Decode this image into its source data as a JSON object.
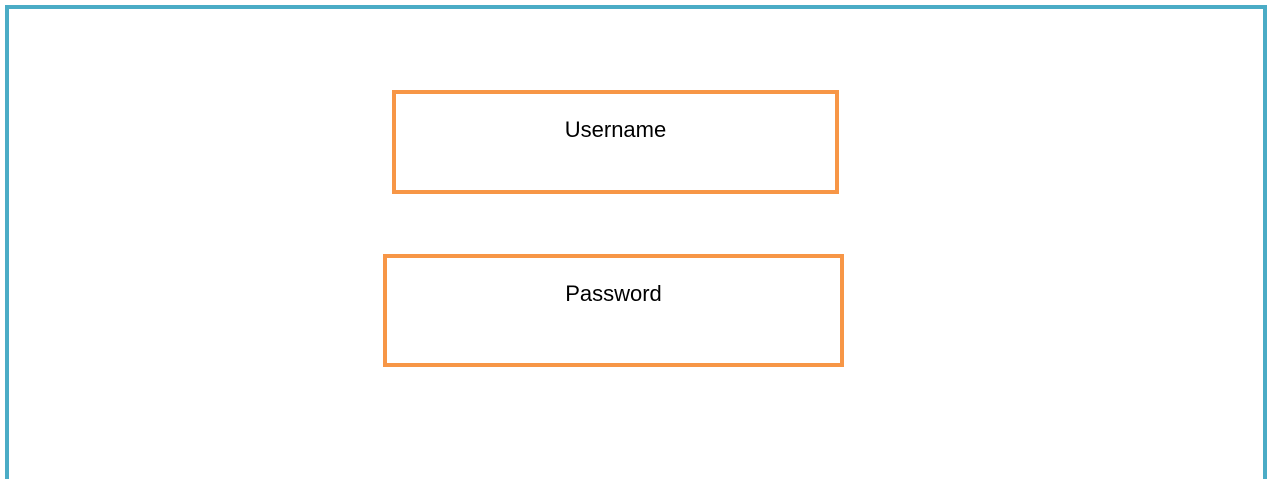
{
  "login_form": {
    "username": {
      "placeholder": "Username",
      "value": ""
    },
    "password": {
      "placeholder": "Password",
      "value": ""
    }
  },
  "colors": {
    "frame_border": "#4BACC6",
    "field_border": "#F79646",
    "background": "#FFFFFF",
    "text": "#000000"
  }
}
